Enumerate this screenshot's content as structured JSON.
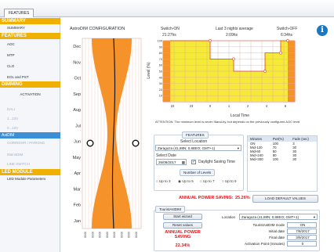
{
  "tabs": [
    "FEATURES"
  ],
  "sidebar": {
    "sections": [
      {
        "label": "SUMMARY",
        "items": [
          {
            "label": "SUMMARY",
            "dim": false
          }
        ]
      },
      {
        "label": "FEATURES",
        "items": [
          {
            "label": "AOC",
            "dim": false
          },
          {
            "label": "MTP",
            "dim": false
          },
          {
            "label": "CLO",
            "dim": false
          },
          {
            "label": "EOL and PST",
            "dim": false
          }
        ]
      },
      {
        "label": "DIMMING",
        "items": []
      }
    ],
    "action_label": "ACTIVATION",
    "dim_items": [
      "DALI",
      "1...10V",
      "0...10V"
    ],
    "selected": "AstDIM",
    "dim_items2": [
      "CORRIDOR / PARKING",
      "MainsDIM",
      "LINE SWITCH"
    ],
    "led_section": "LED MODULE",
    "led_item": "LED Module Parameters"
  },
  "main": {
    "title": "AstroDIM CONFIGURATION",
    "switch_on_label": "Switch-ON",
    "switch_on_time": "21:27hs",
    "avg_label": "Last 3 nights average",
    "avg_time": "2:09hs",
    "switch_off_label": "Switch-OFF",
    "switch_off_time": "6:34hs",
    "info_icon_text": "i",
    "attention": "ATTENTION: The minimum level is never Stand-by, but depends on the previously configured AOC level",
    "features_legend": "FEATURES",
    "select_location_label": "Select Location",
    "location_value": "Zaragoza (41,88N; 0,88EO; GMT+1)",
    "select_date_label": "Select Date",
    "date_value": "26/08/2017",
    "dst_label": "Daylight Saving Time",
    "levels_legend": "Number of Levels",
    "level_options": [
      "Up to 3",
      "Up to 5",
      "Up to 7",
      "Up to 9"
    ],
    "saving_label": "ANNUAL POWER SAVING:",
    "saving_value": "25.26%",
    "load_defaults": "LOAD DEFAULT VALUES",
    "table": {
      "headers": [
        "Minutes",
        "Pwr(%)",
        "Fade (sec)"
      ],
      "rows": [
        [
          "ON",
          "100",
          "3"
        ],
        [
          "Mid-120",
          "70",
          "30"
        ],
        [
          "Mid-60",
          "50",
          "30"
        ],
        [
          "Mid+240",
          "80",
          "30"
        ],
        [
          "Mid+300",
          "100",
          "30"
        ]
      ]
    },
    "tourist_legend": "TouristAstDIM",
    "start_wizard": "Start wizard",
    "reset_values": "Reset values",
    "tourist_saving_title": "ANNUAL POWER SAVING",
    "tourist_saving_value": "22.34%",
    "location_label": "Location",
    "location_value2": "Zaragoza (41,88N; 0,88EO; GMT+1)",
    "tourist_mode_label": "TouristAstDIM mode",
    "tourist_mode_value": "ON",
    "initial_date_label": "Initial date",
    "initial_date_value": "7/8/2017",
    "final_date_label": "Final date",
    "final_date_value": "3/9/2017",
    "activation_label": "Activation Point (minutes)",
    "activation_value": "0"
  },
  "chart_data": [
    {
      "type": "area",
      "y_categories": [
        "Dec",
        "Nov",
        "Oct",
        "Sep",
        "Aug",
        "Jul",
        "Jun",
        "May",
        "Apr",
        "Mar",
        "Feb",
        "Jan"
      ],
      "x_tick_labels": [
        "00:00",
        "00:00",
        "00:00",
        "00:00",
        "00:00",
        "00:00",
        "00:00",
        "00:00"
      ],
      "colors": {
        "band": "#f5922a",
        "line": "#1a1a1a",
        "grid": "#f2cfc6"
      }
    },
    {
      "type": "area",
      "ylabel": "Level (%)",
      "xlabel": "Local Time",
      "ylim": [
        0,
        100
      ],
      "y_ticks": [
        10,
        20,
        30,
        40,
        50,
        60,
        70,
        80,
        90,
        100
      ],
      "x_tick_labels": [
        "22",
        "23",
        "0",
        "1",
        "2",
        "4",
        "6"
      ],
      "series": [
        {
          "values": [
            100,
            70,
            50,
            80,
            100
          ]
        }
      ],
      "colors": {
        "fill": "#f5e93a",
        "on_off": "#f5922a",
        "line": "#e33c2a",
        "grid": "#e7a9a1"
      }
    }
  ]
}
